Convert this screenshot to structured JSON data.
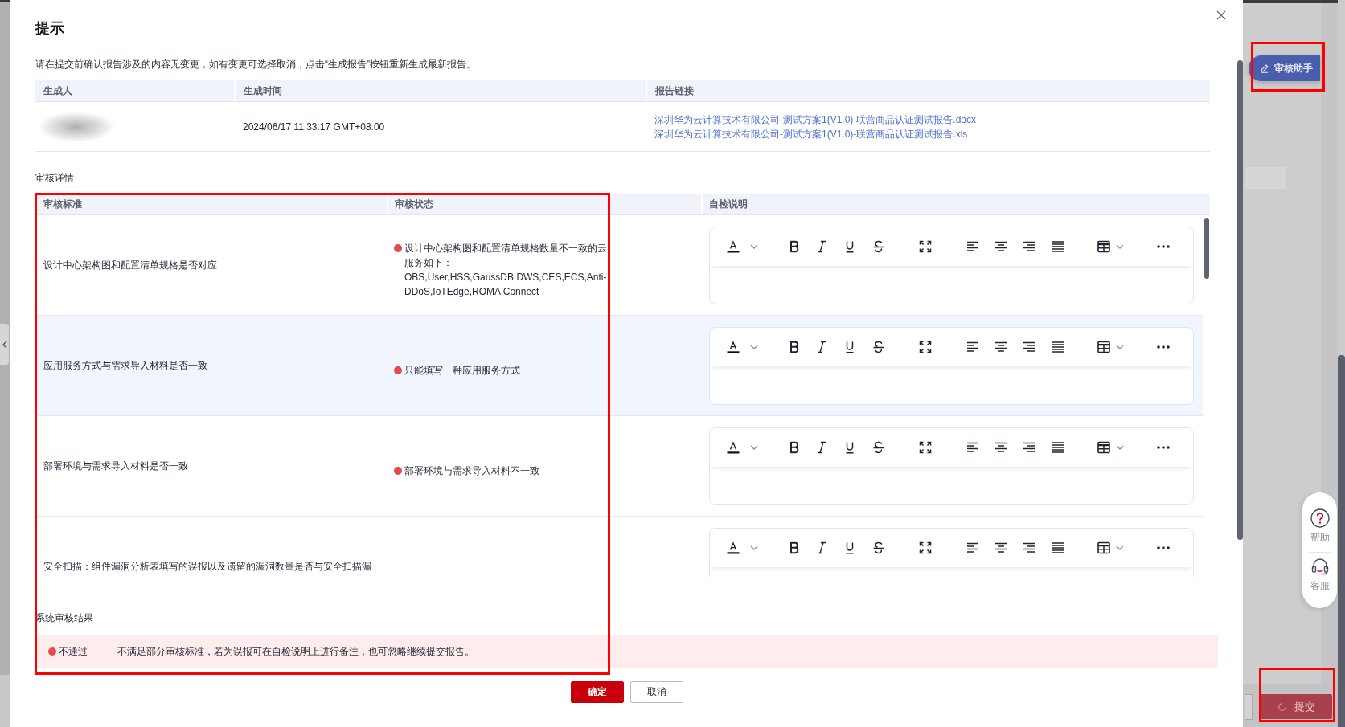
{
  "dialog": {
    "title": "提示",
    "notice": "请在提交前确认报告涉及的内容无变更，如有变更可选择取消，点击“生成报告”按钮重新生成最新报告。"
  },
  "report_table": {
    "columns": [
      "生成人",
      "生成时间",
      "报告链接"
    ],
    "rows": [
      {
        "generated_at": "2024/06/17 11:33:17 GMT+08:00",
        "links": [
          "深圳华为云计算技术有限公司-测试方案1(V1.0)-联营商品认证测试报告.docx",
          "深圳华为云计算技术有限公司-测试方案1(V1.0)-联营商品认证测试报告.xls"
        ]
      }
    ]
  },
  "review": {
    "title": "审核详情",
    "columns": [
      "审核标准",
      "审核状态",
      "自检说明"
    ],
    "rows": [
      {
        "criterion": "设计中心架构图和配置清单规格是否对应",
        "status": "设计中心架构图和配置清单规格数量不一致的云服务如下：\nOBS,User,HSS,GaussDB DWS,CES,ECS,Anti-DDoS,IoTEdge,ROMA Connect",
        "passed": false,
        "highlighted": false
      },
      {
        "criterion": "应用服务方式与需求导入材料是否一致",
        "status": "只能填写一种应用服务方式",
        "passed": false,
        "highlighted": true
      },
      {
        "criterion": "部署环境与需求导入材料是否一致",
        "status": "部署环境与需求导入材料不一致",
        "passed": false,
        "highlighted": false
      },
      {
        "criterion": "安全扫描：组件漏洞分析表填写的误报以及遗留的漏洞数量是否与安全扫描漏",
        "highlighted": false
      }
    ]
  },
  "result": {
    "title": "系统审核结果",
    "passed": false,
    "verdict": "不通过",
    "message": "不满足部分审核标准，若为误报可在自检说明上进行备注，也可忽略继续提交报告。"
  },
  "buttons": [
    {
      "label": "确定",
      "kind": "primary"
    },
    {
      "label": "取消",
      "kind": "secondary"
    }
  ],
  "side_panel": {
    "assistant_button": "审核助手",
    "help_items": [
      {
        "label": "帮助",
        "kind": "help"
      },
      {
        "label": "客服",
        "kind": "service"
      }
    ]
  },
  "page": {
    "submit_button": {
      "label": "提交",
      "loading": true
    }
  }
}
